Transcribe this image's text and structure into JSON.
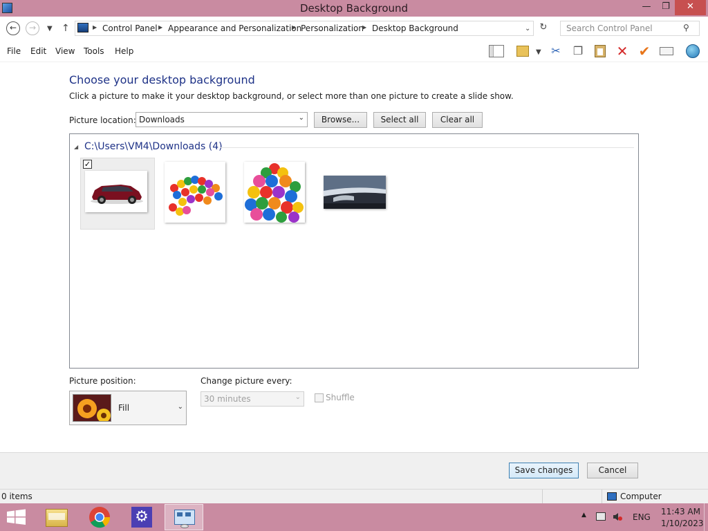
{
  "window": {
    "title": "Desktop Background",
    "minimize_glyph": "—",
    "restore_glyph": "❐",
    "close_glyph": "✕"
  },
  "address_bar": {
    "back_icon": "back-arrow-icon",
    "forward_icon": "forward-arrow-icon",
    "up_icon": "up-arrow-icon",
    "breadcrumbs": [
      "Control Panel",
      "Appearance and Personalization",
      "Personalization",
      "Desktop Background"
    ],
    "search_placeholder": "Search Control Panel"
  },
  "menu": {
    "items": [
      "File",
      "Edit",
      "View",
      "Tools",
      "Help"
    ]
  },
  "toolbar": {
    "icons": [
      "layout-icon",
      "folder-properties-icon",
      "cut-icon",
      "copy-icon",
      "paste-icon",
      "delete-icon",
      "check-icon",
      "rename-icon",
      "globe-icon"
    ]
  },
  "main": {
    "heading": "Choose your desktop background",
    "subtext": "Click a picture to make it your desktop background, or select more than one picture to create a slide show.",
    "picture_location_label": "Picture location:",
    "picture_location_value": "Downloads",
    "browse_label": "Browse...",
    "select_all_label": "Select all",
    "clear_all_label": "Clear all",
    "group_header": "C:\\Users\\VM4\\Downloads (4)",
    "pictures": [
      {
        "name": "red-suv",
        "selected": true
      },
      {
        "name": "colorful-balls",
        "selected": false
      },
      {
        "name": "colorful-eggs",
        "selected": false
      },
      {
        "name": "car-door-handle",
        "selected": false
      }
    ],
    "picture_position_label": "Picture position:",
    "picture_position_value": "Fill",
    "change_every_label": "Change picture every:",
    "change_every_value": "30 minutes",
    "shuffle_label": "Shuffle"
  },
  "footer": {
    "save_label": "Save changes",
    "cancel_label": "Cancel"
  },
  "statusbar": {
    "items_text": "0 items",
    "location_text": "Computer"
  },
  "taskbar": {
    "apps": [
      "start-icon",
      "file-explorer-icon",
      "chrome-icon",
      "settings-icon",
      "control-panel-icon"
    ],
    "language": "ENG",
    "time": "11:43 AM",
    "date": "1/10/2023"
  },
  "colors": {
    "title_bar": "#c98ba1",
    "heading_blue": "#1e3287",
    "close_red": "#c75050"
  }
}
